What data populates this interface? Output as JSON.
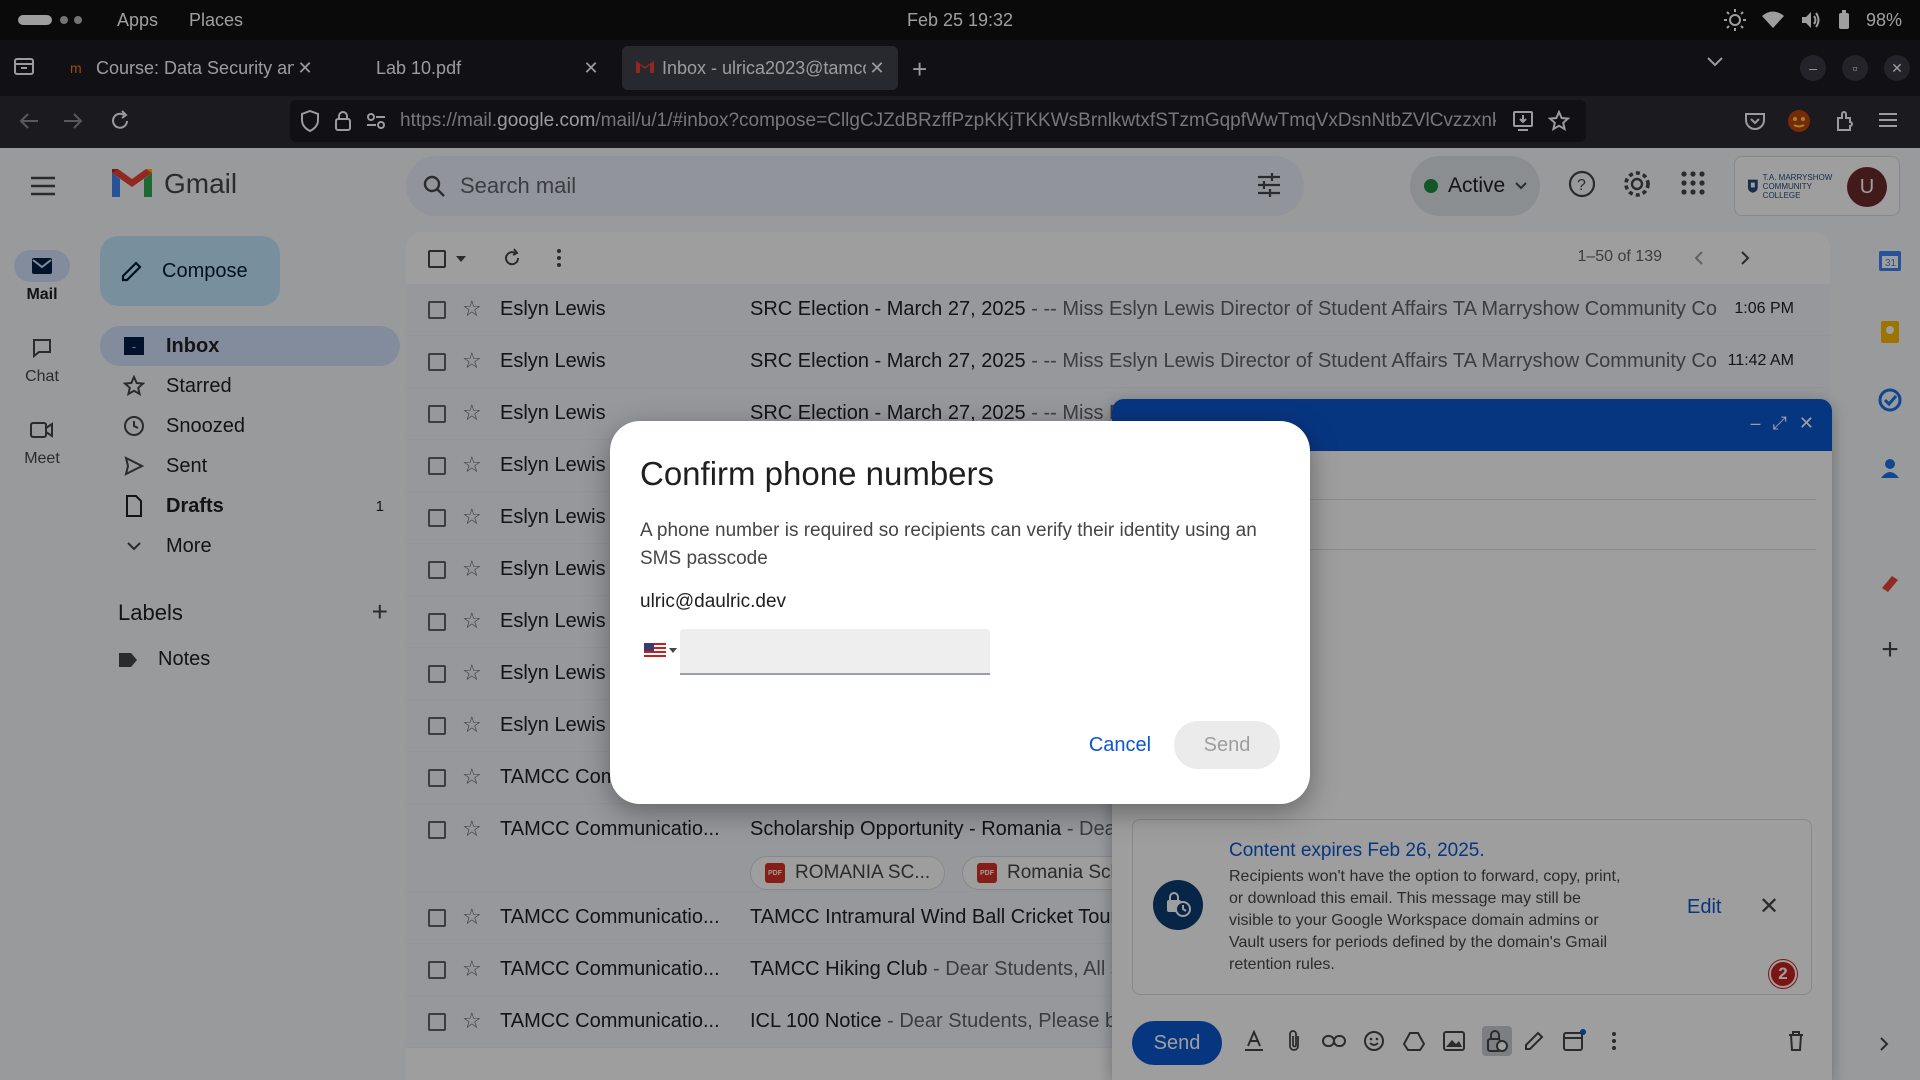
{
  "os": {
    "menu_apps": "Apps",
    "menu_places": "Places",
    "clock": "Feb 25  19:32",
    "battery": "98%"
  },
  "browser": {
    "tabs": [
      {
        "title": "Course: Data Security and",
        "active": false
      },
      {
        "title": "Lab 10.pdf",
        "active": false
      },
      {
        "title": "Inbox - ulrica2023@tamcc",
        "active": true
      }
    ],
    "url_prefix": "https://mail.",
    "url_domain": "google.com",
    "url_rest": "/mail/u/1/#inbox?compose=CllgCJZdBRzffPzpKKjTKKWsBrnlkwtxfSTzmGqpfWwTmqVxDsnNtbZVlCvzzxnkfp"
  },
  "gmail": {
    "logo_text": "Gmail",
    "compose_label": "Compose",
    "rail": [
      {
        "label": "Mail",
        "icon": "mail-icon"
      },
      {
        "label": "Chat",
        "icon": "chat-icon"
      },
      {
        "label": "Meet",
        "icon": "meet-icon"
      }
    ],
    "nav": [
      {
        "label": "Inbox",
        "count": "",
        "icon": "inbox-icon"
      },
      {
        "label": "Starred",
        "count": "",
        "icon": "star-icon"
      },
      {
        "label": "Snoozed",
        "count": "",
        "icon": "clock-icon"
      },
      {
        "label": "Sent",
        "count": "",
        "icon": "send-icon"
      },
      {
        "label": "Drafts",
        "count": "1",
        "icon": "draft-icon"
      },
      {
        "label": "More",
        "count": "",
        "icon": "chevron-down-icon"
      }
    ],
    "labels_heading": "Labels",
    "labels": [
      {
        "name": "Notes"
      }
    ],
    "search_placeholder": "Search mail",
    "status": "Active",
    "pager": "1–50 of 139",
    "account_initial": "U",
    "school_name": "T.A. MARRYSHOW COMMUNITY COLLEGE"
  },
  "emails": [
    {
      "sender": "Eslyn Lewis",
      "subject": "SRC Election - March 27, 2025",
      "snippet": " - -- Miss Eslyn Lewis Director of Student Affairs TA Marryshow Community Col...",
      "time": "1:06 PM"
    },
    {
      "sender": "Eslyn Lewis",
      "subject": "SRC Election - March 27, 2025",
      "snippet": " - -- Miss Eslyn Lewis Director of Student Affairs TA Marryshow Community Col...",
      "time": "11:42 AM"
    },
    {
      "sender": "Eslyn Lewis",
      "subject": "SRC Election - March 27, 2025",
      "snippet": " - -- Miss Es",
      "time": ""
    },
    {
      "sender": "Eslyn Lewis",
      "subject": "",
      "snippet": "",
      "time": ""
    },
    {
      "sender": "Eslyn Lewis",
      "subject": "",
      "snippet": "",
      "time": ""
    },
    {
      "sender": "Eslyn Lewis",
      "subject": "",
      "snippet": "",
      "time": ""
    },
    {
      "sender": "Eslyn Lewis",
      "subject": "",
      "snippet": "",
      "time": ""
    },
    {
      "sender": "Eslyn Lewis",
      "subject": "",
      "snippet": "",
      "time": ""
    },
    {
      "sender": "Eslyn Lewis",
      "subject": "",
      "snippet": "",
      "time": ""
    },
    {
      "sender": "TAMCC Comi",
      "subject": "",
      "snippet": "",
      "time": ""
    },
    {
      "sender": "TAMCC Communicatio...",
      "subject": "Scholarship Opportunity - Romania",
      "snippet": " - Dea",
      "time": ""
    },
    {
      "sender": "TAMCC Communicatio...",
      "subject": "TAMCC Intramural Wind Ball Cricket Tourn",
      "snippet": "",
      "time": ""
    },
    {
      "sender": "TAMCC Communicatio...",
      "subject": "TAMCC Hiking Club",
      "snippet": " - Dear Students, All st",
      "time": ""
    },
    {
      "sender": "TAMCC Communicatio...",
      "subject": "ICL 100 Notice",
      "snippet": " - Dear Students, Please be",
      "time": ""
    }
  ],
  "attachments": [
    "ROMANIA SC...",
    "Romania Sch"
  ],
  "compose_window": {
    "expire_title": "Content expires Feb 26, 2025.",
    "expire_text": "Recipients won't have the option to forward, copy, print, or download this email. This message may still be visible to your Google Workspace domain admins or Vault users for periods defined by the domain's Gmail retention rules.",
    "edit_label": "Edit",
    "notification_count": "2",
    "send_label": "Send"
  },
  "dialog": {
    "title": "Confirm phone numbers",
    "description": "A phone number is required so recipients can verify their identity using an SMS passcode",
    "recipient_email": "ulric@daulric.dev",
    "phone_value": "",
    "phone_placeholder": "",
    "cancel_label": "Cancel",
    "send_label": "Send"
  },
  "colors": {
    "accent": "#0b57d0",
    "compose_bg": "#c2e7ff",
    "selected_nav": "#d3e3fd",
    "notification": "#c5221f"
  }
}
